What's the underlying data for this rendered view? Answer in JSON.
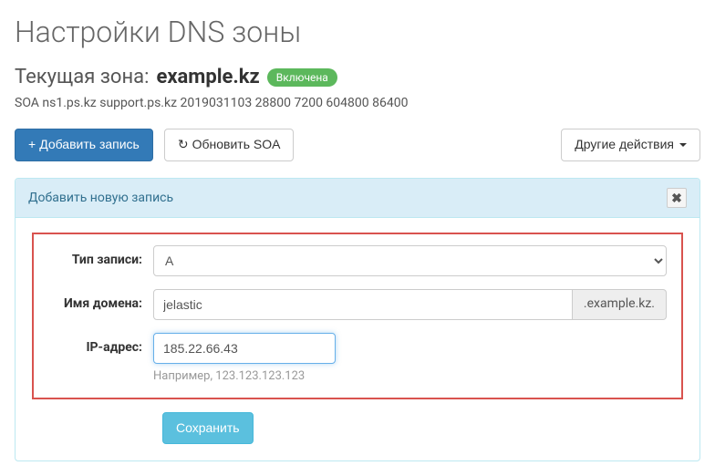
{
  "page_title": "Настройки DNS зоны",
  "current_zone": {
    "label_prefix": "Текущая зона: ",
    "zone": "example.kz",
    "status_badge": "Включена"
  },
  "soa": "SOA ns1.ps.kz support.ps.kz 2019031103 28800 7200 604800 86400",
  "toolbar": {
    "add_record": "Добавить запись",
    "refresh_soa": "Обновить SOA",
    "other_actions": "Другие действия"
  },
  "panel": {
    "title": "Добавить новую запись",
    "close_symbol": "✖",
    "fields": {
      "record_type": {
        "label": "Тип записи:",
        "value": "A"
      },
      "domain_name": {
        "label": "Имя домена:",
        "value": "jelastic",
        "suffix": ".example.kz."
      },
      "ip_address": {
        "label": "IP-адрес:",
        "value": "185.22.66.43",
        "hint": "Например, 123.123.123.123"
      }
    },
    "save_label": "Сохранить"
  }
}
